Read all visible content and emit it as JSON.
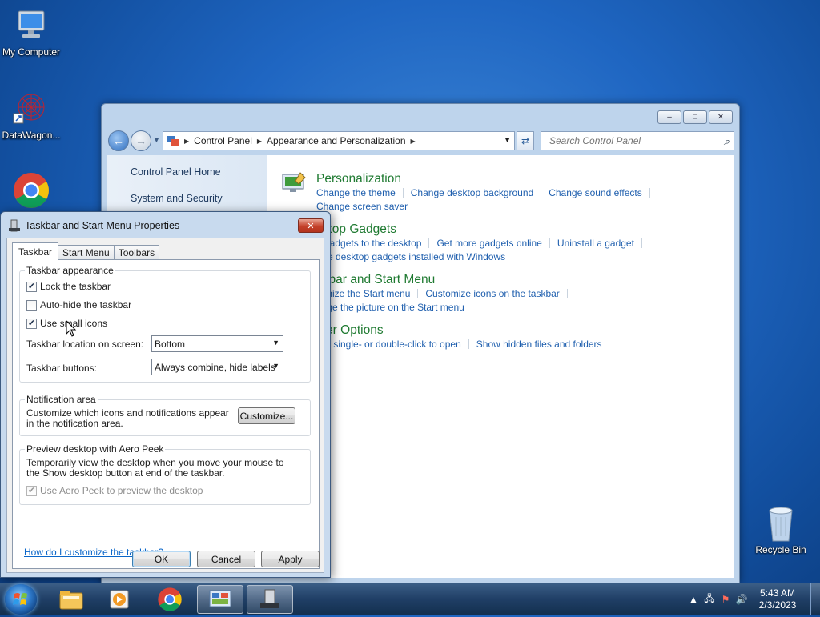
{
  "desktop": {
    "icons": [
      {
        "label": "My Computer"
      },
      {
        "label": "DataWagon..."
      },
      {
        "label": "Recycle Bin"
      }
    ]
  },
  "control_panel": {
    "address": {
      "crumbs": [
        "Control Panel",
        "Appearance and Personalization"
      ]
    },
    "search_placeholder": "Search Control Panel",
    "sidebar": [
      "Control Panel Home",
      "System and Security"
    ],
    "categories": [
      {
        "title": "Personalization",
        "links": [
          "Change the theme",
          "Change desktop background",
          "Change sound effects",
          "Change screen saver"
        ]
      },
      {
        "title": "sktop Gadgets",
        "links": [
          "d gadgets to the desktop",
          "Get more gadgets online",
          "Uninstall a gadget",
          "tore desktop gadgets installed with Windows"
        ]
      },
      {
        "title": "skbar and Start Menu",
        "links": [
          "tomize the Start menu",
          "Customize icons on the taskbar",
          "ange the picture on the Start menu"
        ]
      },
      {
        "title": "lder Options",
        "links": [
          "cify single- or double-click to open",
          "Show hidden files and folders"
        ]
      }
    ]
  },
  "dialog": {
    "title": "Taskbar and Start Menu Properties",
    "tabs": [
      "Taskbar",
      "Start Menu",
      "Toolbars"
    ],
    "appearance": {
      "group_title": "Taskbar appearance",
      "lock": {
        "label": "Lock the taskbar",
        "checked": true
      },
      "autohide": {
        "label": "Auto-hide the taskbar",
        "checked": false
      },
      "small_icons": {
        "label": "Use small icons",
        "checked": true
      },
      "location_label": "Taskbar location on screen:",
      "location_value": "Bottom",
      "buttons_label": "Taskbar buttons:",
      "buttons_value": "Always combine, hide labels"
    },
    "notification": {
      "group_title": "Notification area",
      "text": "Customize which icons and notifications appear in the notification area.",
      "button": "Customize..."
    },
    "aero": {
      "group_title": "Preview desktop with Aero Peek",
      "text": "Temporarily view the desktop when you move your mouse to the Show desktop button at end of the taskbar.",
      "checkbox": {
        "label": "Use Aero Peek to preview the desktop",
        "checked": true
      }
    },
    "help_link": "How do I customize the taskbar?",
    "ok": "OK",
    "cancel": "Cancel",
    "apply": "Apply"
  },
  "taskbar": {
    "clock_time": "5:43 AM",
    "clock_date": "2/3/2023"
  }
}
